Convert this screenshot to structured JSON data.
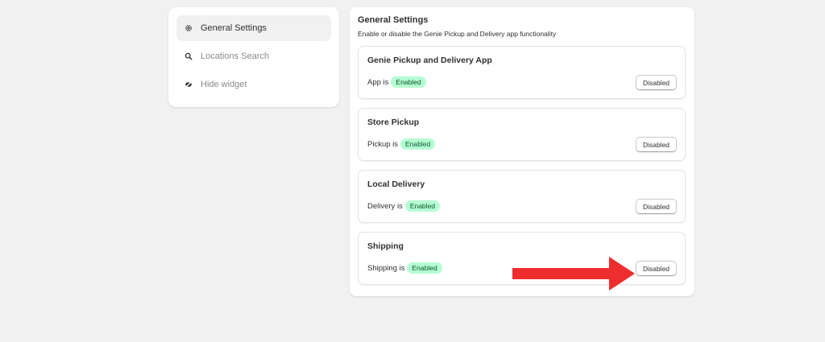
{
  "sidebar": {
    "items": [
      {
        "label": "General Settings",
        "icon": "gear-icon",
        "active": true
      },
      {
        "label": "Locations Search",
        "icon": "search-icon",
        "active": false
      },
      {
        "label": "Hide widget",
        "icon": "hide-icon",
        "active": false
      }
    ]
  },
  "main": {
    "title": "General Settings",
    "subtitle": "Enable or disable the Genie Pickup and Delivery app functionality",
    "cards": [
      {
        "title": "Genie Pickup and Delivery App",
        "status_prefix": "App is",
        "badge": "Enabled",
        "button": "Disabled"
      },
      {
        "title": "Store Pickup",
        "status_prefix": "Pickup is",
        "badge": "Enabled",
        "button": "Disabled"
      },
      {
        "title": "Local Delivery",
        "status_prefix": "Delivery is",
        "badge": "Enabled",
        "button": "Disabled"
      },
      {
        "title": "Shipping",
        "status_prefix": "Shipping is",
        "badge": "Enabled",
        "button": "Disabled"
      }
    ]
  },
  "annotation": {
    "arrow_icon": "red-arrow-icon",
    "arrow_color": "#ee2e2e"
  },
  "colors": {
    "background": "#f1f1f1",
    "badge_bg": "#b4fed2",
    "badge_text": "#0c5132"
  }
}
